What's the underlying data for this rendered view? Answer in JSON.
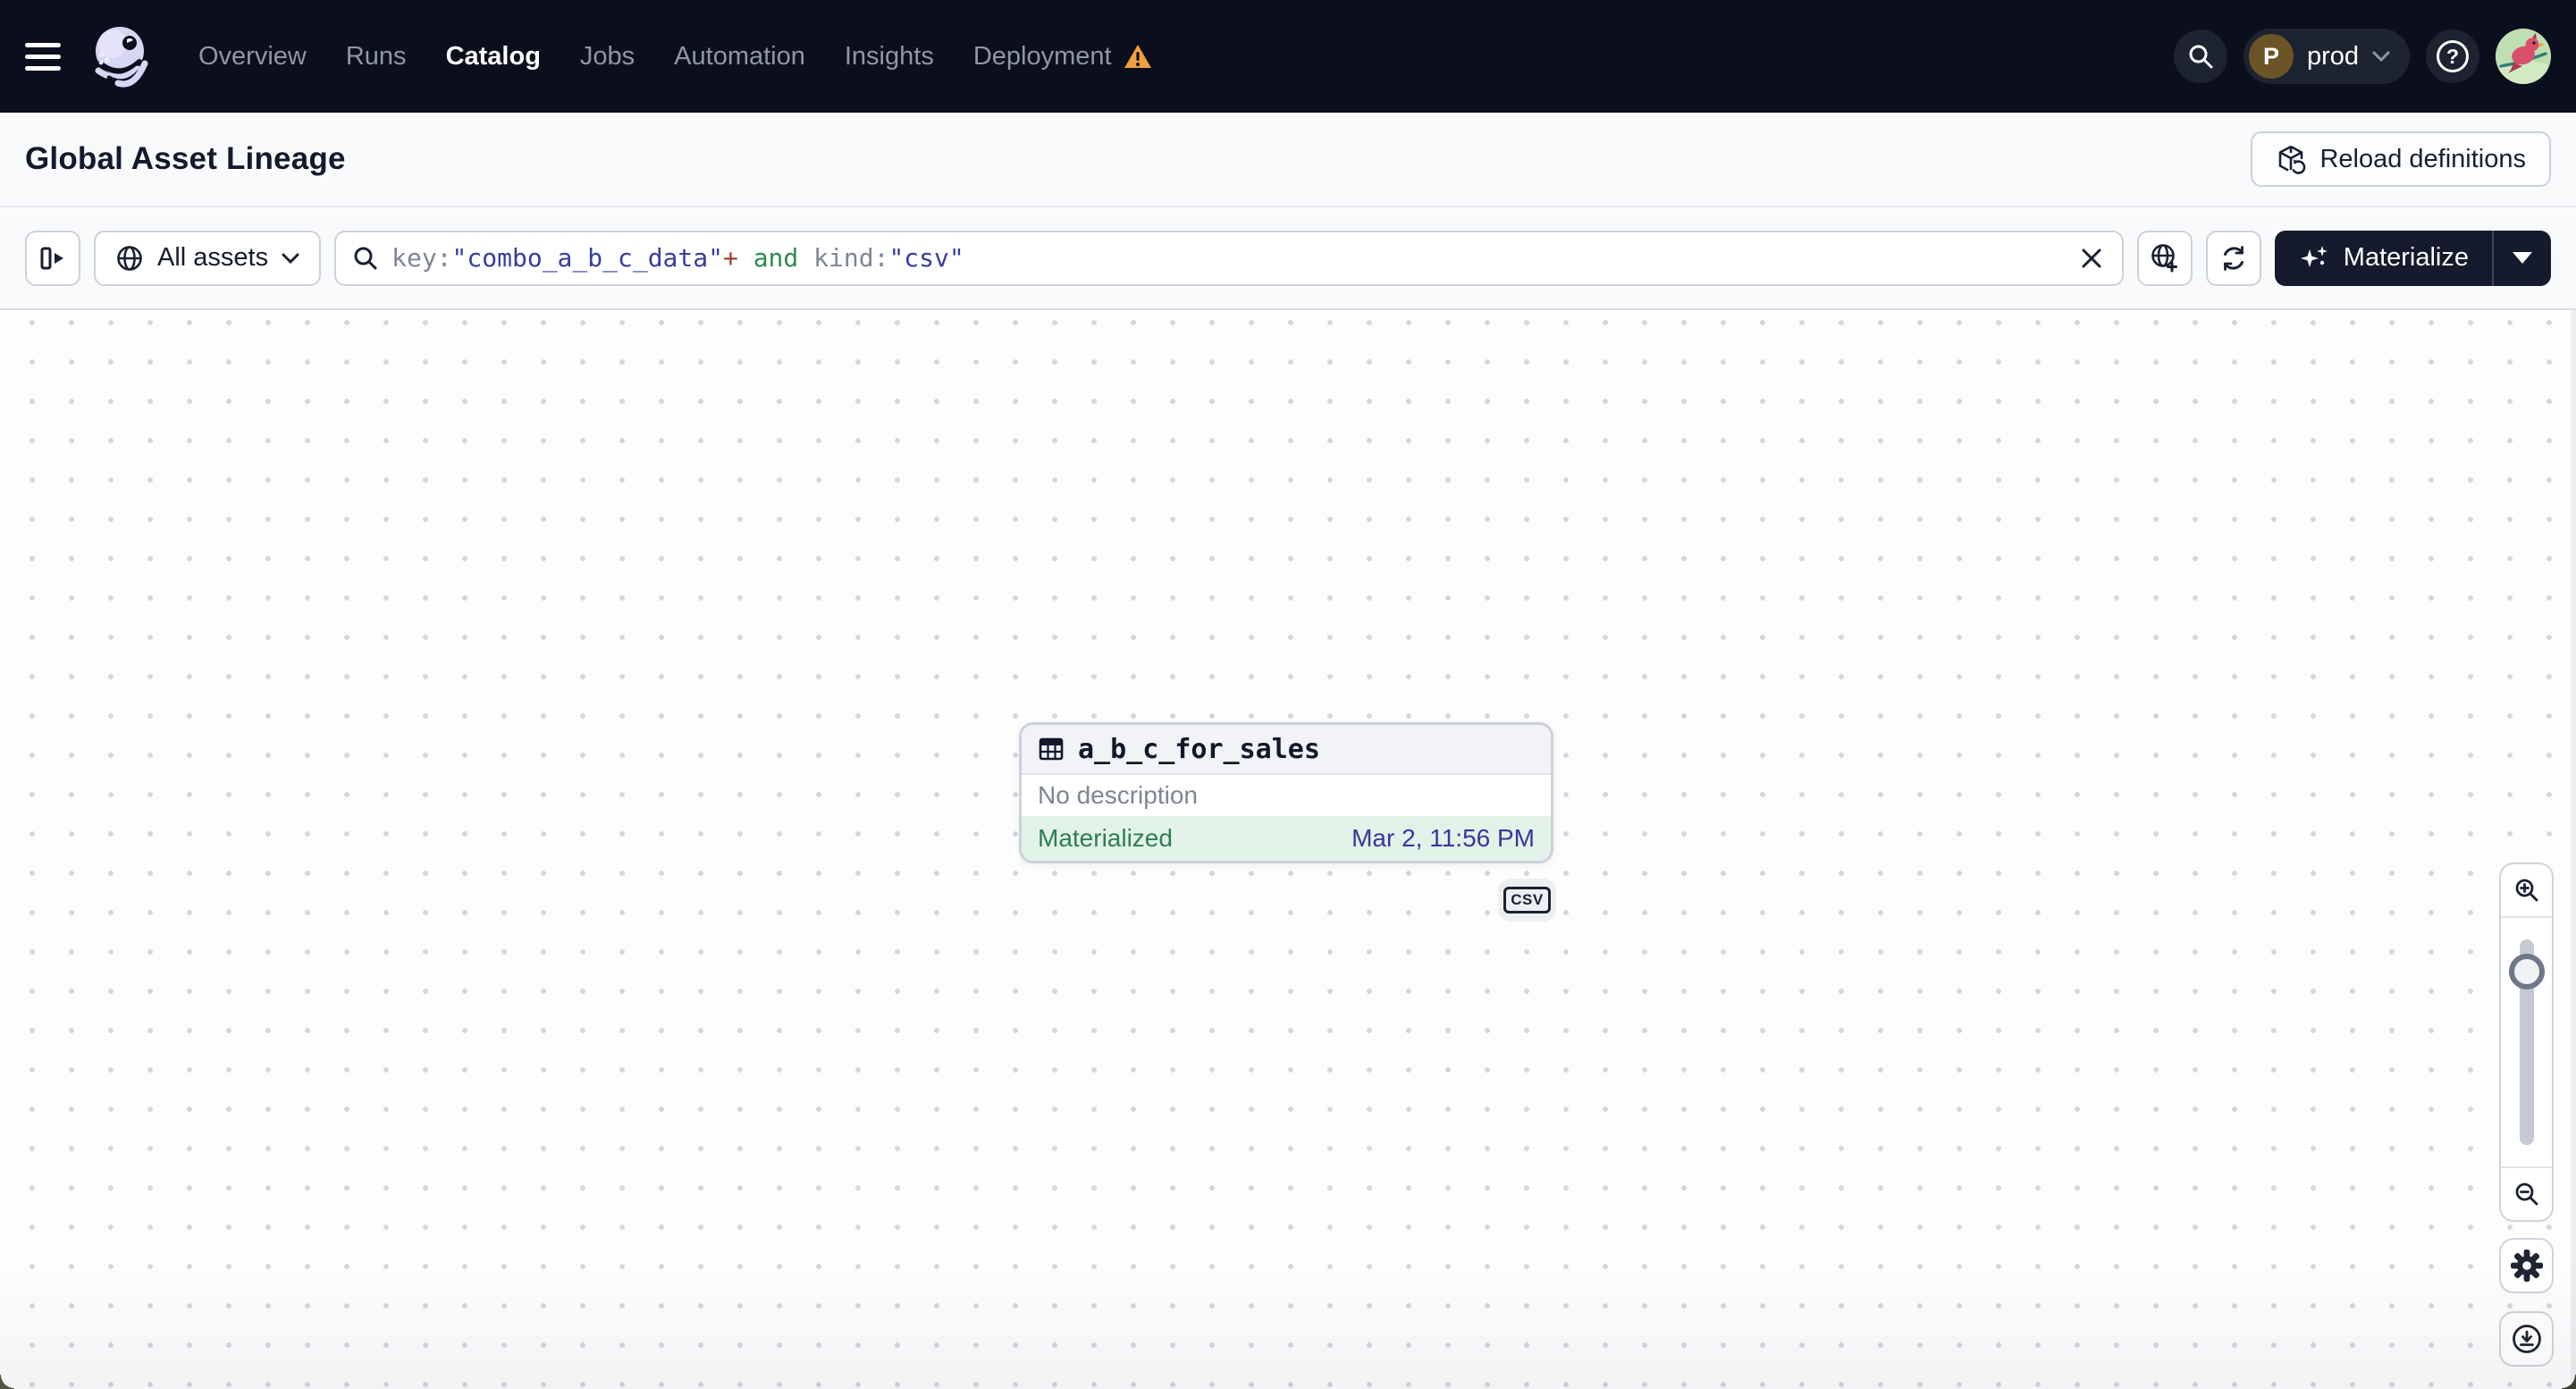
{
  "nav": {
    "items": [
      {
        "label": "Overview",
        "active": false
      },
      {
        "label": "Runs",
        "active": false
      },
      {
        "label": "Catalog",
        "active": true
      },
      {
        "label": "Jobs",
        "active": false
      },
      {
        "label": "Automation",
        "active": false
      },
      {
        "label": "Insights",
        "active": false
      },
      {
        "label": "Deployment",
        "active": false,
        "warning": true
      }
    ],
    "deployment_switcher": {
      "avatar_letter": "P",
      "label": "prod"
    },
    "help_glyph": "?",
    "icons": [
      "hamburger-icon",
      "dagster-octopus-logo",
      "search-icon",
      "chevron-down-icon",
      "help-icon",
      "user-avatar-bird"
    ]
  },
  "header": {
    "title": "Global Asset Lineage",
    "reload_button_label": "Reload definitions"
  },
  "toolbar": {
    "asset_filter_label": "All assets",
    "search": {
      "value": "key:\"combo_a_b_c_data\"+ and kind:\"csv\"",
      "tokens": [
        {
          "text": "key:",
          "type": "key"
        },
        {
          "text": "\"combo_a_b_c_data\"",
          "type": "string"
        },
        {
          "text": "+",
          "type": "operator"
        },
        {
          "text": " and ",
          "type": "keyword"
        },
        {
          "text": "kind:",
          "type": "key"
        },
        {
          "text": "\"csv\"",
          "type": "string"
        }
      ]
    },
    "materialize_label": "Materialize",
    "icons": [
      "panel-toggle-icon",
      "globe-icon",
      "clear-x-icon",
      "globe-add-icon",
      "refresh-icon",
      "sparkles-icon",
      "caret-down-icon"
    ]
  },
  "graph": {
    "node": {
      "title": "a_b_c_for_sales",
      "description": "No description",
      "status": "Materialized",
      "materialized_at": "Mar 2, 11:56 PM",
      "kind_tag": "CSV"
    }
  },
  "colors": {
    "topnav_bg": "#0b0e1c",
    "dark_button_bg": "#151a2c",
    "status_green": "#2d7f51",
    "status_green_bg": "#e3f2e9",
    "timestamp_indigo": "#34399b",
    "warning_orange": "#f0a03c",
    "token_string": "#383da0",
    "token_keyword": "#2e8a50",
    "token_operator": "#9c3d2e",
    "canvas_dot": "#d4d7df"
  }
}
